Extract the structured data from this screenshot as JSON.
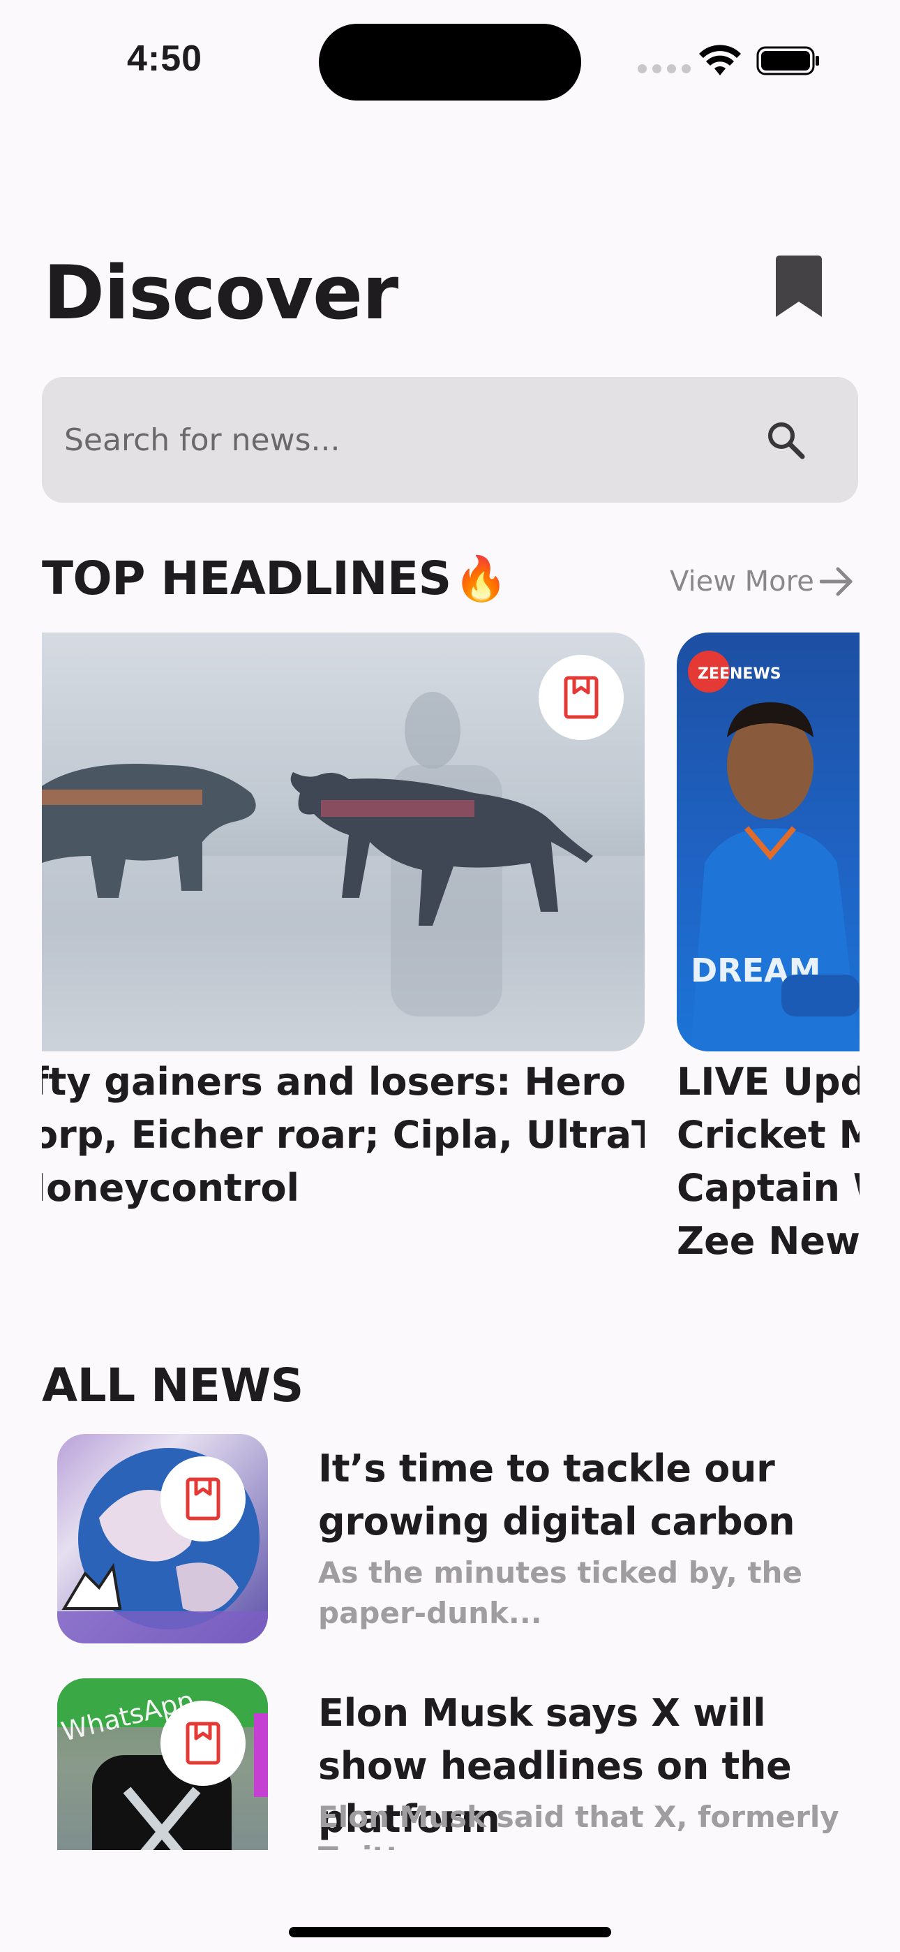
{
  "status_bar": {
    "time": "4:50"
  },
  "header": {
    "title": "Discover"
  },
  "search": {
    "placeholder": "Search for news..."
  },
  "top_headlines": {
    "title": "TOP HEADLINES",
    "emoji": "🔥",
    "view_more": "View More",
    "cards": [
      {
        "title_lines": [
          "fty gainers and losers: Hero",
          "orp, Eicher roar; Cipla, UltraTech",
          "Ioneycontrol"
        ]
      },
      {
        "badge": "ZEENEWS",
        "title_lines": [
          "LIVE Upda",
          "Cricket Ma",
          "Captain W",
          "Zee News"
        ]
      }
    ]
  },
  "all_news": {
    "title": "ALL NEWS",
    "items": [
      {
        "title": "It’s time to tackle our growing digital carbon",
        "desc": "As the minutes ticked by, the paper-dunk..."
      },
      {
        "title": "Elon Musk says X will show headlines on the platform",
        "desc": "Elon Musk said that X, formerly Twitter...",
        "thumb_label": "WhatsApp"
      }
    ]
  },
  "colors": {
    "accent_red": "#e53935",
    "background": "#fcf9fc",
    "search_bg": "#e3e1e3",
    "bookmark_dark": "#444244"
  },
  "icons": [
    "wifi-icon",
    "battery-icon",
    "bookmark-icon",
    "search-icon",
    "arrow-right-icon",
    "bookmark-outline-icon"
  ]
}
